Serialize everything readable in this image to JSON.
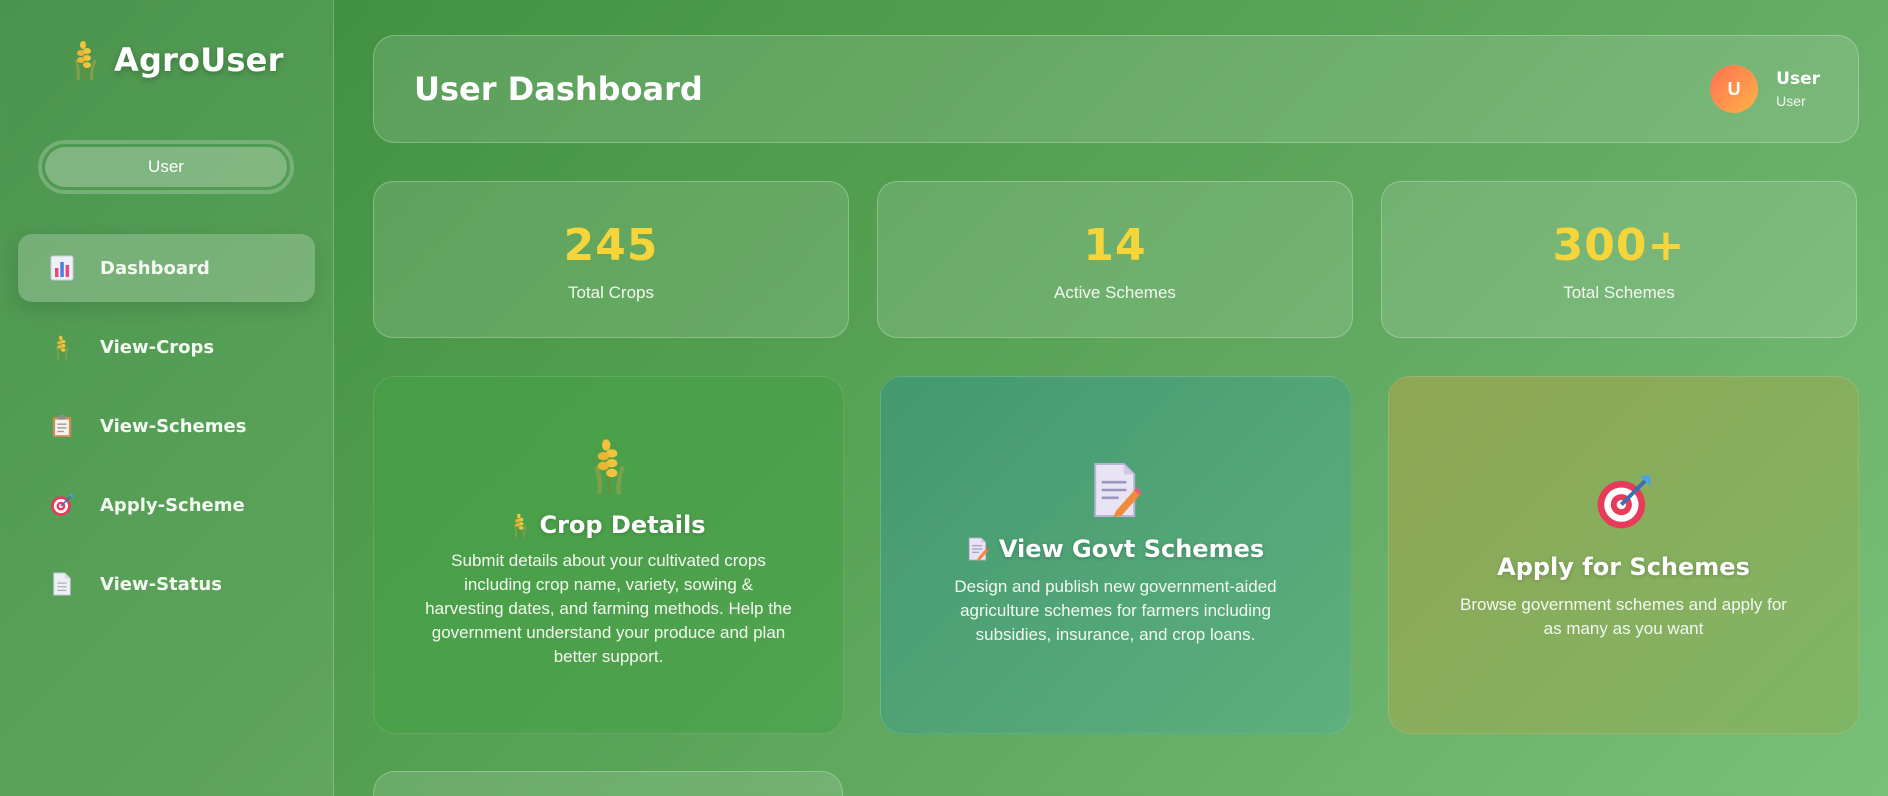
{
  "brand": {
    "name": "AgroUser",
    "icon": "wheat-icon"
  },
  "sidebar": {
    "role": "User",
    "items": [
      {
        "label": "Dashboard",
        "icon": "bar-chart-icon",
        "active": true
      },
      {
        "label": "View-Crops",
        "icon": "wheat-icon",
        "active": false
      },
      {
        "label": "View-Schemes",
        "icon": "clipboard-icon",
        "active": false
      },
      {
        "label": "Apply-Scheme",
        "icon": "target-icon",
        "active": false
      },
      {
        "label": "View-Status",
        "icon": "document-icon",
        "active": false
      }
    ]
  },
  "header": {
    "title": "User Dashboard",
    "user": {
      "initial": "U",
      "name": "User",
      "role": "User"
    }
  },
  "stats": [
    {
      "value": "245",
      "label": "Total Crops"
    },
    {
      "value": "14",
      "label": "Active Schemes"
    },
    {
      "value": "300+",
      "label": "Total Schemes"
    }
  ],
  "cards": [
    {
      "title": "Crop Details",
      "icon": "wheat-icon",
      "desc": "Submit details about your cultivated crops including crop name, variety, sowing & harvesting dates, and farming methods. Help the government understand your produce and plan better support."
    },
    {
      "title": "View Govt Schemes",
      "icon": "memo-icon",
      "desc": "Design and publish new government-aided agriculture schemes for farmers including subsidies, insurance, and crop loans."
    },
    {
      "title": "Apply for Schemes",
      "icon": "target-icon",
      "desc": "Browse government schemes and apply for as many as you want"
    }
  ],
  "colors": {
    "accent_stat": "#f6d53b",
    "avatar_from": "#ff6f52",
    "avatar_to": "#ffb347"
  }
}
